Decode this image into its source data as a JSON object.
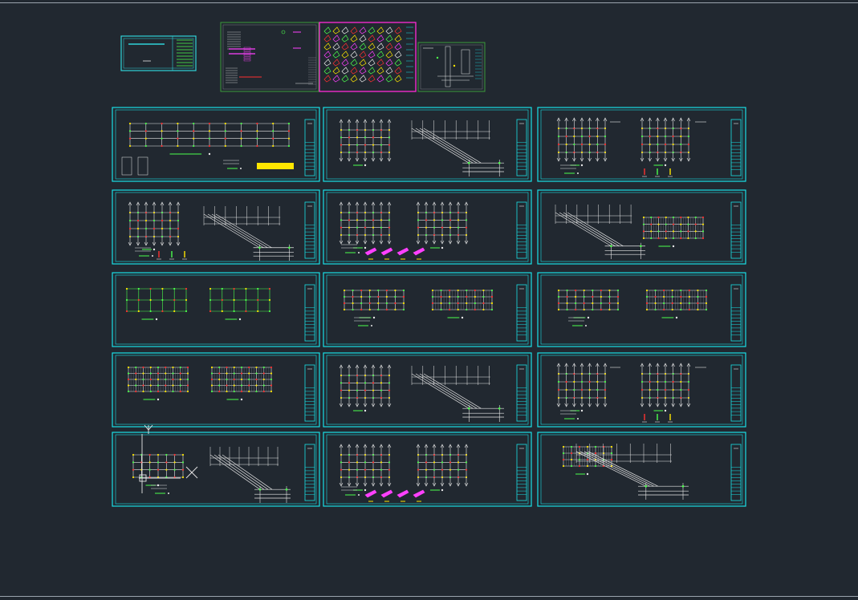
{
  "app": {
    "title": "",
    "view": "model-space"
  },
  "colors": {
    "background": "#212830",
    "sheet_frame": "#19e0e6",
    "sheet_frame_inner": "#19e0e6",
    "cover_frame": "#2fd3d8",
    "detail_frame_magenta": "#ff2bd6",
    "detail_frame_green": "#3c9a3a",
    "rebar_green": "#4cff4c",
    "rebar_white": "#e8e8e8",
    "accent_yellow": "#ffe600",
    "accent_red": "#ff3030",
    "accent_magenta": "#ff40ff",
    "grid_gray": "#8a8f96",
    "dim_white": "#cfd4da"
  },
  "drawing": {
    "cover_sheet": {
      "icon": "title-block-icon"
    },
    "overview_sheets": [
      {
        "name": "general-notes-sheet",
        "frame": "green"
      },
      {
        "name": "detail-sheet",
        "frame": "magenta"
      },
      {
        "name": "section-sheet",
        "frame": "green"
      }
    ],
    "sheets": [
      {
        "row": 1,
        "col": 1,
        "content": "long-plan"
      },
      {
        "row": 1,
        "col": 2,
        "content": "plan-stair"
      },
      {
        "row": 1,
        "col": 3,
        "content": "two-plans"
      },
      {
        "row": 2,
        "col": 1,
        "content": "plan-stair-right"
      },
      {
        "row": 2,
        "col": 2,
        "content": "two-plans-magenta"
      },
      {
        "row": 2,
        "col": 3,
        "content": "stair-and-grid"
      },
      {
        "row": 3,
        "col": 1,
        "content": "two-grids-green"
      },
      {
        "row": 3,
        "col": 2,
        "content": "two-grids"
      },
      {
        "row": 3,
        "col": 3,
        "content": "two-grids"
      },
      {
        "row": 4,
        "col": 1,
        "content": "two-dense-grids"
      },
      {
        "row": 4,
        "col": 2,
        "content": "plan-stair"
      },
      {
        "row": 4,
        "col": 3,
        "content": "two-plans"
      },
      {
        "row": 5,
        "col": 1,
        "content": "plan-stair-cursor"
      },
      {
        "row": 5,
        "col": 2,
        "content": "two-plans-magenta"
      },
      {
        "row": 5,
        "col": 3,
        "content": "single-stair"
      }
    ],
    "cursor": {
      "icon": "crosshair-cursor-icon"
    }
  }
}
